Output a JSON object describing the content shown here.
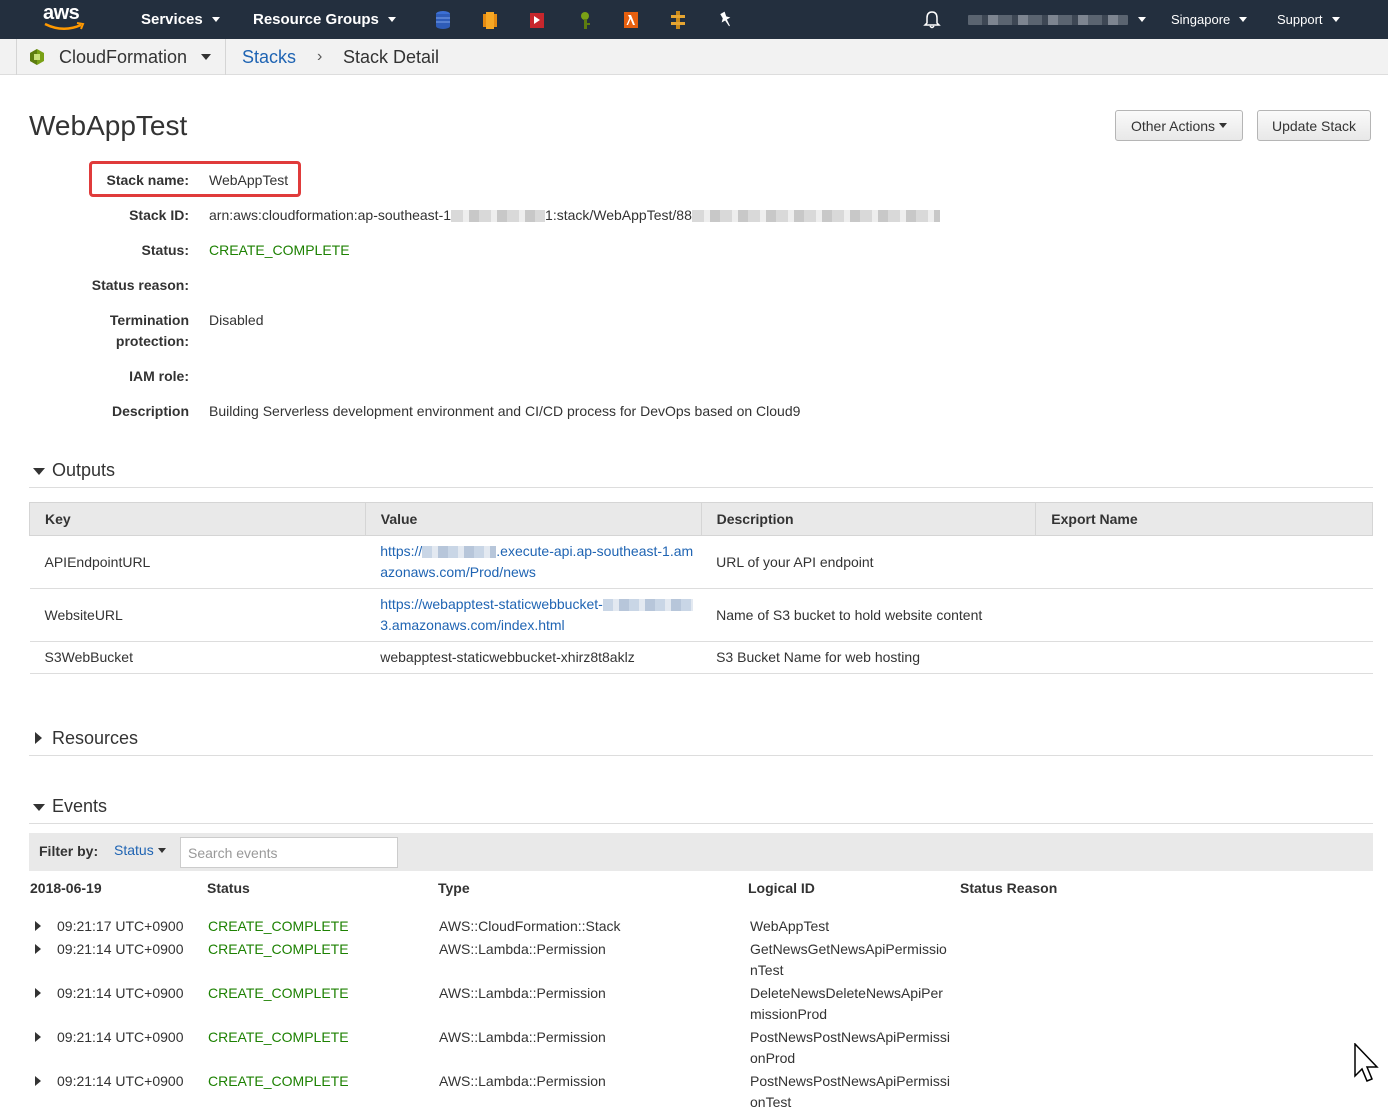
{
  "topnav": {
    "services": "Services",
    "resource_groups": "Resource Groups",
    "region": "Singapore",
    "support": "Support"
  },
  "breadcrumb": {
    "service": "CloudFormation",
    "stacks": "Stacks",
    "separator": "›",
    "current": "Stack Detail"
  },
  "page": {
    "title": "WebAppTest",
    "other_actions": "Other Actions",
    "update_stack": "Update Stack"
  },
  "details": {
    "stack_name_label": "Stack name:",
    "stack_name": "WebAppTest",
    "stack_id_label": "Stack ID:",
    "stack_id_prefix": "arn:aws:cloudformation:ap-southeast-1",
    "stack_id_mid": "1:stack/WebAppTest/88",
    "status_label": "Status:",
    "status": "CREATE_COMPLETE",
    "status_reason_label": "Status reason:",
    "termination_label_1": "Termination",
    "termination_label_2": "protection:",
    "termination": "Disabled",
    "iam_role_label": "IAM role:",
    "description_label": "Description",
    "description": "Building Serverless development environment and CI/CD process for DevOps based on Cloud9"
  },
  "outputs": {
    "section_label": "Outputs",
    "headers": [
      "Key",
      "Value",
      "Description",
      "Export Name"
    ],
    "rows": [
      {
        "key": "APIEndpointURL",
        "value_a": "https://",
        "value_b": ".execute-api.ap-southeast-1.am",
        "value_c": "azonaws.com/Prod/news",
        "description": "URL of your API endpoint",
        "export": ""
      },
      {
        "key": "WebsiteURL",
        "value_a": "https://webapptest-staticwebbucket-",
        "value_b": "",
        "value_c": "3.amazonaws.com/index.html",
        "description": "Name of S3 bucket to hold website content",
        "export": ""
      },
      {
        "key": "S3WebBucket",
        "value_a": "webapptest-staticwebbucket-xhirz8t8aklz",
        "value_b": "",
        "value_c": "",
        "description": "S3 Bucket Name for web hosting",
        "export": ""
      }
    ]
  },
  "resources": {
    "section_label": "Resources"
  },
  "events": {
    "section_label": "Events",
    "filter_label": "Filter by:",
    "filter_value": "Status",
    "search_placeholder": "Search events",
    "date": "2018-06-19",
    "headers": {
      "status": "Status",
      "type": "Type",
      "logical_id": "Logical ID",
      "status_reason": "Status Reason"
    },
    "rows": [
      {
        "time": "09:21:17 UTC+0900",
        "status": "CREATE_COMPLETE",
        "type": "AWS::CloudFormation::Stack",
        "logical_id": "WebAppTest"
      },
      {
        "time": "09:21:14 UTC+0900",
        "status": "CREATE_COMPLETE",
        "type": "AWS::Lambda::Permission",
        "logical_id": "GetNewsGetNewsApiPermissionTest"
      },
      {
        "time": "09:21:14 UTC+0900",
        "status": "CREATE_COMPLETE",
        "type": "AWS::Lambda::Permission",
        "logical_id": "DeleteNewsDeleteNewsApiPermissionProd"
      },
      {
        "time": "09:21:14 UTC+0900",
        "status": "CREATE_COMPLETE",
        "type": "AWS::Lambda::Permission",
        "logical_id": "PostNewsPostNewsApiPermissionProd"
      },
      {
        "time": "09:21:14 UTC+0900",
        "status": "CREATE_COMPLETE",
        "type": "AWS::Lambda::Permission",
        "logical_id": "PostNewsPostNewsApiPermissionTest"
      }
    ]
  },
  "colors": {
    "nav_bg": "#232f3e",
    "link": "#1f64b3",
    "success": "#1d8102",
    "highlight": "#e03b3b"
  }
}
